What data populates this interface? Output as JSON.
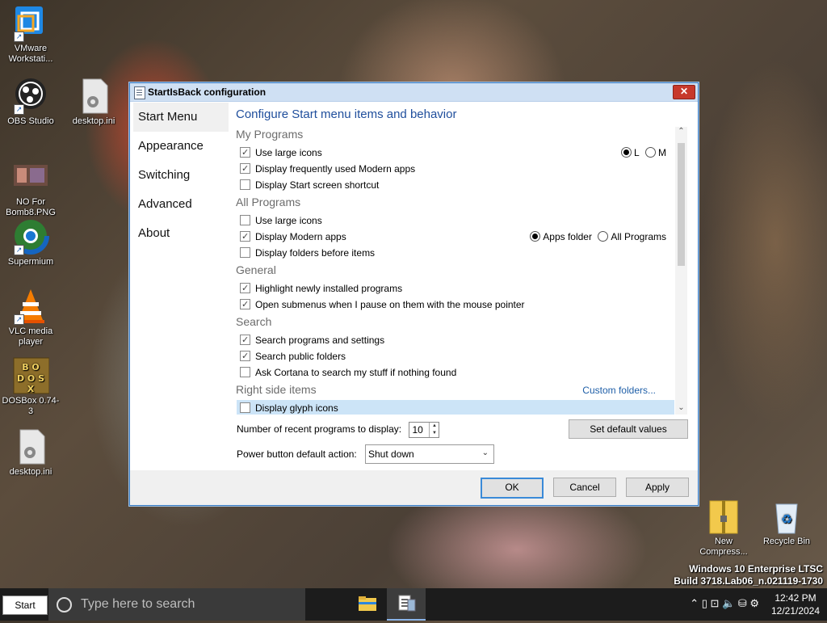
{
  "desktop": {
    "icons": [
      {
        "label": "VMware Workstati...",
        "glyph": "⧉",
        "color": "#1e88e5"
      },
      {
        "label": "OBS Studio",
        "glyph": "◉",
        "color": "#222222"
      },
      {
        "label": "desktop.ini",
        "glyph": "⚙",
        "color": "#9e9e9e"
      },
      {
        "label": "NO For Bomb8.PNG",
        "glyph": "▦",
        "color": "#795548"
      },
      {
        "label": "Supermium",
        "glyph": "◍",
        "color": "#1976d2"
      },
      {
        "label": "VLC media player",
        "glyph": "▲",
        "color": "#f57c00"
      },
      {
        "label": "DOSBox 0.74-3",
        "glyph": "DOS",
        "color": "#8d6e2a"
      },
      {
        "label": "desktop.ini",
        "glyph": "⚙",
        "color": "#9e9e9e"
      },
      {
        "label": "New Compress...",
        "glyph": "▮",
        "color": "#f2c94c"
      },
      {
        "label": "Recycle Bin",
        "glyph": "♻",
        "color": "#9bb8d6"
      }
    ],
    "watermark": {
      "line1": "Windows 10 Enterprise LTSC",
      "line2": "Build 3718.Lab06_n.021119-1730"
    }
  },
  "window": {
    "title": "StartIsBack configuration",
    "close_glyph": "✕",
    "sidebar": [
      "Start Menu",
      "Appearance",
      "Switching",
      "Advanced",
      "About"
    ],
    "heading": "Configure Start menu items and behavior",
    "groups": {
      "my_programs": "My Programs",
      "all_programs": "All Programs",
      "general": "General",
      "search": "Search",
      "right_side": "Right side items"
    },
    "options": {
      "mp_large_icons": "Use large icons",
      "mp_frequent_modern": "Display frequently used Modern apps",
      "mp_start_shortcut": "Display Start screen shortcut",
      "ap_large_icons": "Use large icons",
      "ap_modern_apps": "Display Modern apps",
      "ap_folders_before": "Display folders before items",
      "gen_highlight": "Highlight newly installed programs",
      "gen_submenus": "Open submenus when I pause on them with the mouse pointer",
      "search_programs": "Search programs and settings",
      "search_public": "Search public folders",
      "search_cortana": "Ask Cortana to search my stuff if nothing found",
      "rs_glyph_icons": "Display glyph icons"
    },
    "size_radio": {
      "l": "L",
      "m": "M"
    },
    "modern_radio": {
      "apps_folder": "Apps folder",
      "all_programs": "All Programs"
    },
    "custom_folders_link": "Custom folders...",
    "recent_label": "Number of recent programs to display:",
    "recent_value": "10",
    "spin_up": "▲",
    "spin_down": "▼",
    "set_default_button": "Set default values",
    "power_label": "Power button default action:",
    "power_value": "Shut down",
    "dropdown_glyph": "⌄",
    "scroll_up_glyph": "⌃",
    "scroll_down_glyph": "⌄",
    "ok_button": "OK",
    "cancel_button": "Cancel",
    "apply_button": "Apply"
  },
  "taskbar": {
    "start_label": "Start",
    "search_placeholder": "Type here to search",
    "tray_glyphs": "⌃ ▯ ⊡ 🔈 ⛁ ⚙",
    "time": "12:42 PM",
    "date": "12/21/2024"
  }
}
